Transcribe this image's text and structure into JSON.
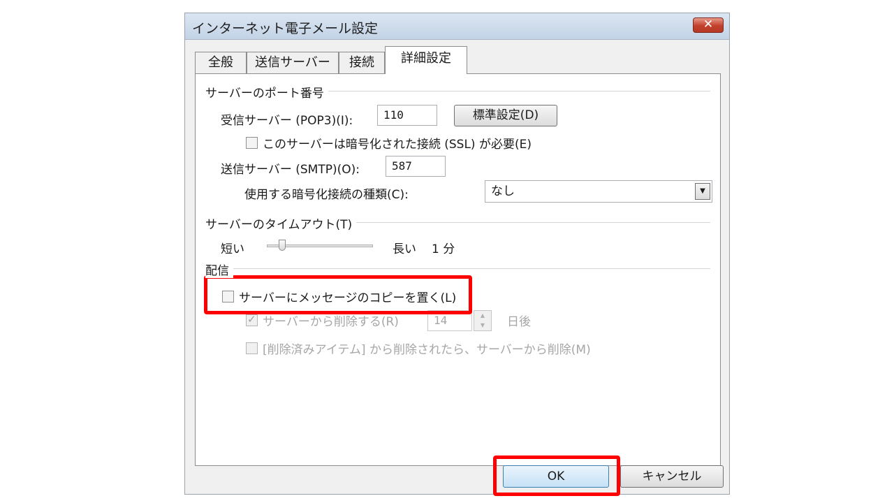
{
  "window": {
    "title": "インターネット電子メール設定",
    "close_symbol": "✕"
  },
  "tabs": [
    {
      "label": "全般",
      "active": false
    },
    {
      "label": "送信サーバー",
      "active": false
    },
    {
      "label": "接続",
      "active": false
    },
    {
      "label": "詳細設定",
      "active": true
    }
  ],
  "ports": {
    "section_title": "サーバーのポート番号",
    "incoming_label": "受信サーバー (POP3)(I):",
    "incoming_value": "110",
    "default_button": "標準設定(D)",
    "ssl_checkbox_label": "このサーバーは暗号化された接続 (SSL) が必要(E)",
    "ssl_checked": false,
    "outgoing_label": "送信サーバー (SMTP)(O):",
    "outgoing_value": "587",
    "encryption_label": "使用する暗号化接続の種類(C):",
    "encryption_value": "なし"
  },
  "timeout": {
    "section_title": "サーバーのタイムアウト(T)",
    "short_label": "短い",
    "long_label": "長い",
    "value_text": "1 分",
    "slider_fraction": 0.12
  },
  "delivery": {
    "section_title": "配信",
    "leave_copy_label": "サーバーにメッセージのコピーを置く(L)",
    "leave_copy_checked": false,
    "remove_after_label": "サーバーから削除する(R)",
    "remove_after_checked": true,
    "remove_after_days": "14",
    "days_unit": "日後",
    "remove_deleted_label": "[削除済みアイテム] から削除されたら、サーバーから削除(M)",
    "remove_deleted_checked": false
  },
  "footer": {
    "ok_label": "OK",
    "cancel_label": "キャンセル"
  },
  "colors": {
    "highlight": "#ff0000",
    "close_button": "#c2402c"
  }
}
